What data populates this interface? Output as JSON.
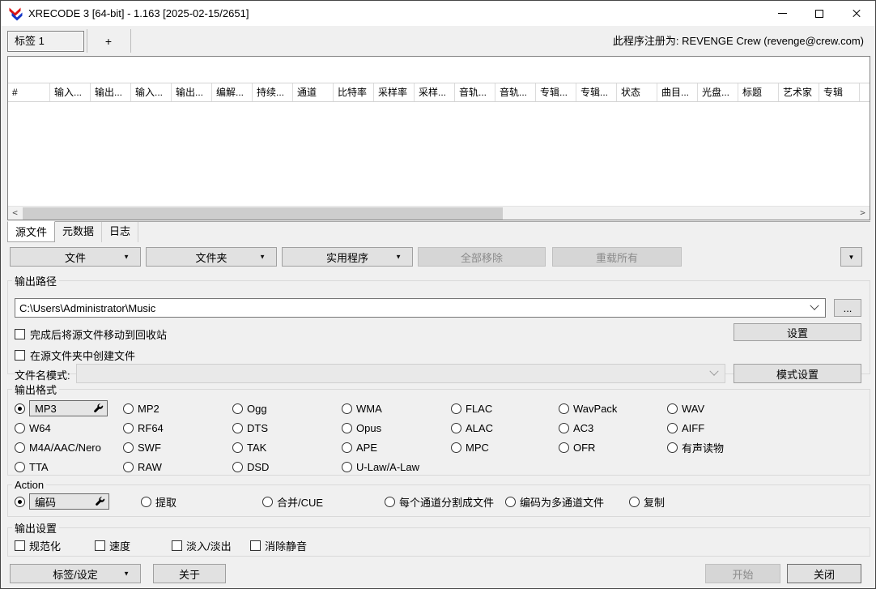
{
  "window": {
    "title": "XRECODE 3 [64-bit] - 1.163 [2025-02-15/2651]",
    "registration": "此程序注册为: REVENGE Crew (revenge@crew.com)",
    "tab_label": "标签 1",
    "add_tab_label": "+"
  },
  "icons": {
    "dropdown": "▼",
    "scroll_left": "<",
    "scroll_right": ">"
  },
  "colors": {
    "logo_red": "#dc1414",
    "logo_blue": "#1638c8",
    "window_bg": "#f0f0f0",
    "disabled_text": "#8b8b8b"
  },
  "table": {
    "columns": [
      "#",
      "输入...",
      "输出...",
      "输入...",
      "输出...",
      "编解...",
      "持续...",
      "通道",
      "比特率",
      "采样率",
      "采样...",
      "音轨...",
      "音轨...",
      "专辑...",
      "专辑...",
      "状态",
      "曲目...",
      "光盘...",
      "标题",
      "艺术家",
      "专辑"
    ],
    "rows": []
  },
  "lower_tabs": {
    "items": [
      "源文件",
      "元数据",
      "日志"
    ],
    "active": "源文件"
  },
  "toolbar": {
    "file_button": "文件",
    "folder_button": "文件夹",
    "utilities_button": "实用程序",
    "remove_all_button": "全部移除",
    "reload_all_button": "重载所有"
  },
  "output_path": {
    "legend": "输出路径",
    "path_value": "C:\\Users\\Administrator\\Music",
    "browse_button": "...",
    "settings_button": "设置",
    "recycle_checkbox": "完成后将源文件移动到回收站",
    "create_in_source_checkbox": "在源文件夹中创建文件",
    "filename_pattern_label": "文件名模式:",
    "filename_pattern_value": "",
    "pattern_settings_button": "模式设置"
  },
  "output_format": {
    "legend": "输出格式",
    "selected": "MP3",
    "options": [
      "MP3",
      "MP2",
      "Ogg",
      "WMA",
      "FLAC",
      "WavPack",
      "WAV",
      "W64",
      "RF64",
      "DTS",
      "Opus",
      "ALAC",
      "AC3",
      "AIFF",
      "M4A/AAC/Nero",
      "SWF",
      "TAK",
      "APE",
      "MPC",
      "OFR",
      "有声读物",
      "TTA",
      "RAW",
      "DSD",
      "U-Law/A-Law"
    ]
  },
  "action": {
    "legend": "Action",
    "selected": "编码",
    "options": [
      "编码",
      "提取",
      "合并/CUE",
      "每个通道分割成文件",
      "编码为多通道文件",
      "复制"
    ]
  },
  "output_settings": {
    "legend": "输出设置",
    "options": [
      "规范化",
      "速度",
      "淡入/淡出",
      "消除静音"
    ]
  },
  "footer": {
    "tags_settings_button": "标签/设定",
    "about_button": "关于",
    "start_button": "开始",
    "close_button": "关闭"
  }
}
